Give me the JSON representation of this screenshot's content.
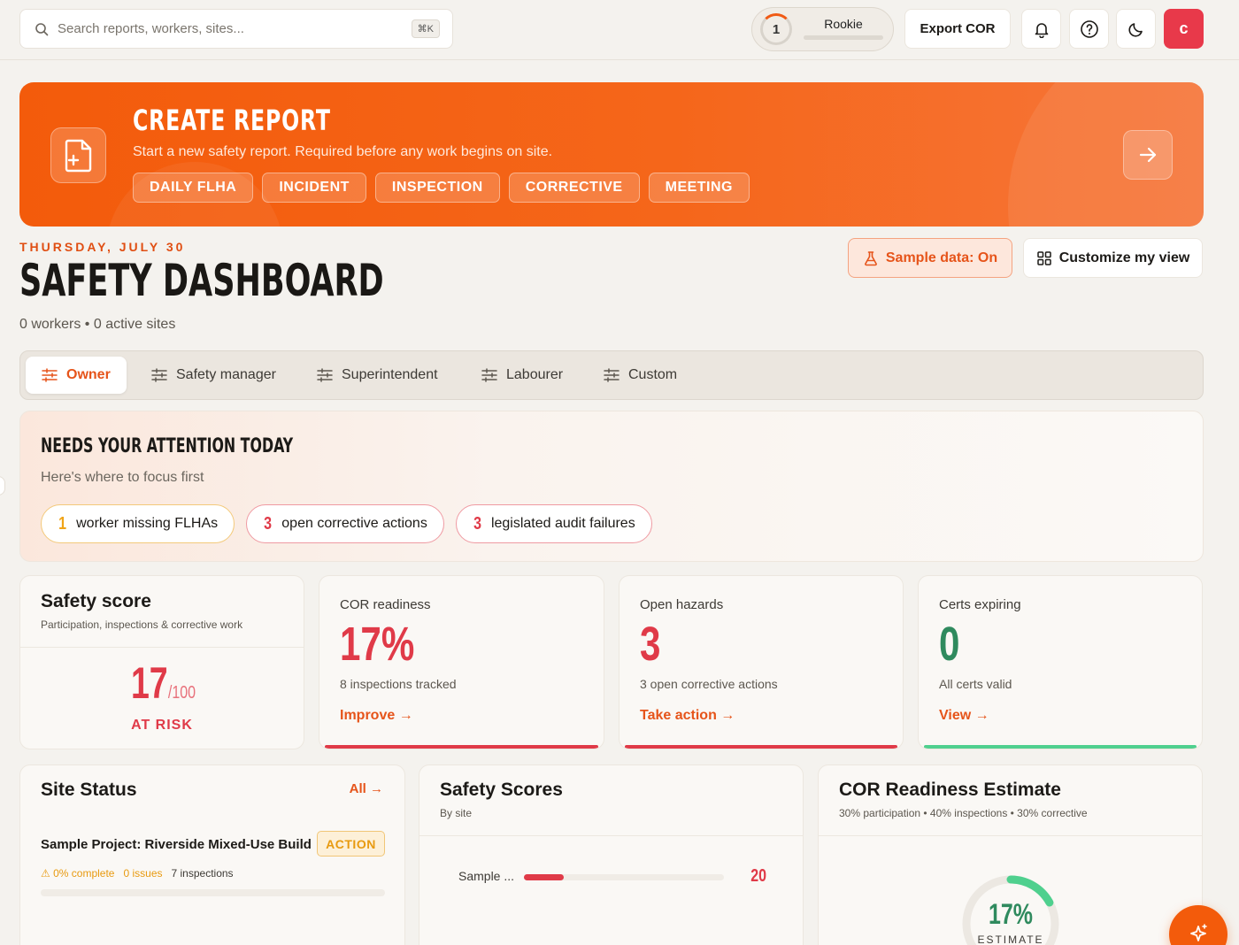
{
  "search": {
    "placeholder": "Search reports, workers, sites...",
    "shortcut": "⌘K"
  },
  "rank": {
    "level": "1",
    "title": "Rookie"
  },
  "header": {
    "export_label": "Export COR",
    "avatar_initial": "c"
  },
  "banner": {
    "title": "CREATE REPORT",
    "subtitle": "Start a new safety report. Required before any work begins on site.",
    "chips": [
      "DAILY FLHA",
      "INCIDENT",
      "INSPECTION",
      "CORRECTIVE",
      "MEETING"
    ]
  },
  "page": {
    "date": "THURSDAY, JULY 30",
    "title": "SAFETY DASHBOARD",
    "subtitle": "0 workers • 0 active sites",
    "sample_data_label": "Sample data: On",
    "customize_label": "Customize my view"
  },
  "tabs": [
    {
      "label": "Owner",
      "active": true
    },
    {
      "label": "Safety manager"
    },
    {
      "label": "Superintendent"
    },
    {
      "label": "Labourer"
    },
    {
      "label": "Custom"
    }
  ],
  "attention": {
    "title": "NEEDS YOUR ATTENTION TODAY",
    "subtitle": "Here's where to focus first",
    "items": [
      {
        "count": "1",
        "label": "worker missing FLHAs",
        "tone": "amber"
      },
      {
        "count": "3",
        "label": "open corrective actions",
        "tone": "red"
      },
      {
        "count": "3",
        "label": "legislated audit failures",
        "tone": "red"
      }
    ]
  },
  "safety_score": {
    "title": "Safety score",
    "description": "Participation, inspections & corrective work",
    "value": "17",
    "max": "/100",
    "status": "AT RISK"
  },
  "stats": [
    {
      "label": "COR readiness",
      "value": "17%",
      "sub": "8 inspections tracked",
      "link": "Improve →",
      "color": "#e03a48"
    },
    {
      "label": "Open hazards",
      "value": "3",
      "sub": "3 open corrective actions",
      "link": "Take action →",
      "color": "#e03a48"
    },
    {
      "label": "Certs expiring",
      "value": "0",
      "sub": "All certs valid",
      "link": "View →",
      "color": "#2f8a5e"
    }
  ],
  "site_status": {
    "title": "Site Status",
    "all_label": "All →",
    "site": {
      "name": "Sample Project: Riverside Mixed-Use Build",
      "badge": "ACTION",
      "complete": "⚠ 0% complete",
      "issues": "0 issues",
      "inspections": "7 inspections",
      "progress": 0
    }
  },
  "safety_scores": {
    "title": "Safety Scores",
    "subtitle": "By site",
    "rows": [
      {
        "label": "Sample ...",
        "value": "20",
        "fraction": 0.2
      }
    ]
  },
  "cor_estimate": {
    "title": "COR Readiness Estimate",
    "subtitle": "30% participation • 40% inspections • 30% corrective",
    "value": "17%",
    "label": "ESTIMATE",
    "fraction": 0.17
  },
  "colors": {
    "accent": "#f35b0b",
    "danger": "#e03a48",
    "success": "#2f8a5e",
    "warning": "#f0a418"
  }
}
